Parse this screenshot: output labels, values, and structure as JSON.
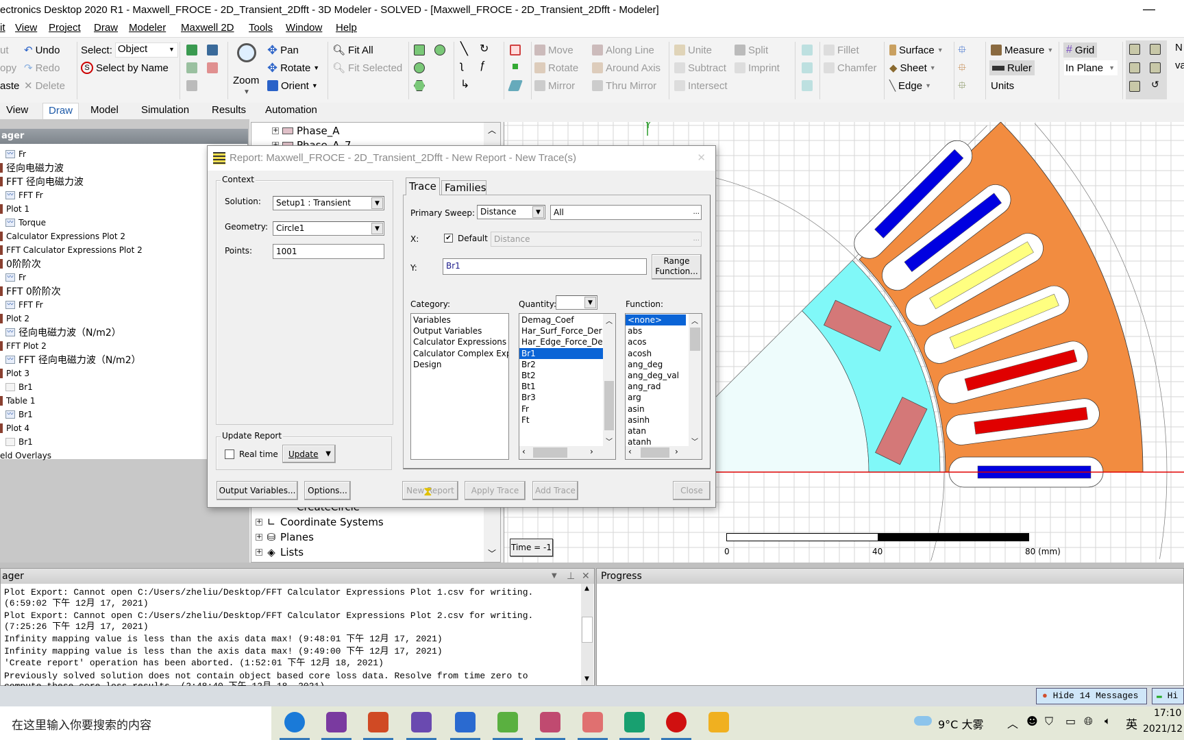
{
  "window": {
    "title": "ectronics Desktop 2020 R1 - Maxwell_FROCE - 2D_Transient_2Dfft - 3D Modeler - SOLVED - [Maxwell_FROCE - 2D_Transient_2Dfft - Modeler]",
    "minimize": "—"
  },
  "menu": [
    "it",
    "View",
    "Project",
    "Draw",
    "Modeler",
    "Maxwell 2D",
    "Tools",
    "Window",
    "Help"
  ],
  "ribbon": {
    "cut": "ut",
    "copy": "opy",
    "paste": "aste",
    "undo": "Undo",
    "redo": "Redo",
    "delete": "Delete",
    "select_label": "Select:",
    "select_value": "Object",
    "select_by_name": "Select by Name",
    "zoom": "Zoom",
    "pan": "Pan",
    "rotate": "Rotate",
    "orient": "Orient",
    "fit_all": "Fit All",
    "fit_selected": "Fit Selected",
    "move": "Move",
    "rotate2": "Rotate",
    "mirror": "Mirror",
    "along_line": "Along Line",
    "around_axis": "Around Axis",
    "thru_mirror": "Thru Mirror",
    "unite": "Unite",
    "subtract": "Subtract",
    "intersect": "Intersect",
    "split": "Split",
    "imprint": "Imprint",
    "fillet": "Fillet",
    "chamfer": "Chamfer",
    "surface": "Surface",
    "sheet": "Sheet",
    "edge": "Edge",
    "measure": "Measure",
    "ruler": "Ruler",
    "units": "Units",
    "grid": "Grid",
    "in_plane": "In Plane",
    "cut_right_1": "N",
    "cut_right_2": "va"
  },
  "tabs": [
    {
      "label": "View"
    },
    {
      "label": "Draw",
      "active": true
    },
    {
      "label": "Model"
    },
    {
      "label": "Simulation"
    },
    {
      "label": "Results"
    },
    {
      "label": "Automation"
    }
  ],
  "project_manager": {
    "header": "ager",
    "items": [
      {
        "label": "Fr",
        "level": 1,
        "icon": "trace"
      },
      {
        "label": "径向电磁力波",
        "level": 0,
        "icon": "report"
      },
      {
        "label": "FFT 径向电磁力波",
        "level": 0,
        "icon": "report"
      },
      {
        "label": "FFT Fr",
        "level": 1,
        "icon": "trace"
      },
      {
        "label": "Plot 1",
        "level": 0,
        "icon": "report"
      },
      {
        "label": "Torque",
        "level": 1,
        "icon": "trace"
      },
      {
        "label": "Calculator Expressions Plot 2",
        "level": 0,
        "icon": "report"
      },
      {
        "label": "FFT Calculator Expressions Plot 2",
        "level": 0,
        "icon": "report"
      },
      {
        "label": "0阶阶次",
        "level": 0,
        "icon": "report"
      },
      {
        "label": "Fr",
        "level": 1,
        "icon": "trace"
      },
      {
        "label": "FFT 0阶阶次",
        "level": 0,
        "icon": "report"
      },
      {
        "label": "FFT Fr",
        "level": 1,
        "icon": "trace"
      },
      {
        "label": "Plot 2",
        "level": 0,
        "icon": "report"
      },
      {
        "label": "径向电磁力波（N/m2）",
        "level": 1,
        "icon": "trace"
      },
      {
        "label": "FFT  Plot 2",
        "level": 0,
        "icon": "report"
      },
      {
        "label": "FFT 径向电磁力波（N/m2）",
        "level": 1,
        "icon": "trace"
      },
      {
        "label": "Plot 3",
        "level": 0,
        "icon": "report"
      },
      {
        "label": "Br1",
        "level": 1,
        "icon": "table"
      },
      {
        "label": "Table 1",
        "level": 0,
        "icon": "report"
      },
      {
        "label": "Br1",
        "level": 1,
        "icon": "trace"
      },
      {
        "label": "Plot 4",
        "level": 0,
        "icon": "report"
      },
      {
        "label": "Br1",
        "level": 1,
        "icon": "table"
      },
      {
        "label": "eld Overlays",
        "level": 0,
        "icon": "none"
      }
    ]
  },
  "model_tree": {
    "top_items": [
      "Phase_A",
      "Phase_A_7"
    ],
    "partial_item": "CreateCircle",
    "bottom_items": [
      "Coordinate Systems",
      "Planes",
      "Lists"
    ]
  },
  "viewer": {
    "axis_label": "Y",
    "time_label": "Time = -1",
    "scale_labels": [
      "0",
      "40",
      "80 (mm)"
    ],
    "colors": {
      "stator": "#f28c40",
      "rotor": "#80f8f8",
      "shaft": "#eefcfc",
      "magnet": "#d47878",
      "axis_line": "#e00000"
    },
    "coil_colors": [
      "#0000e0",
      "#e00000",
      "#e00000",
      "#ffff80",
      "#ffff80",
      "#0000e0",
      "#0000e0"
    ]
  },
  "dialog": {
    "title": "Report: Maxwell_FROCE - 2D_Transient_2Dfft - New Report - New Trace(s)",
    "context": {
      "label": "Context",
      "solution_label": "Solution:",
      "solution_value": "Setup1 : Transient",
      "geometry_label": "Geometry:",
      "geometry_value": "Circle1",
      "points_label": "Points:",
      "points_value": "1001"
    },
    "update_report": {
      "label": "Update Report",
      "realtime_label": "Real time",
      "realtime_checked": false,
      "update_button": "Update"
    },
    "tabs": [
      {
        "label": "Trace",
        "active": true
      },
      {
        "label": "Families"
      }
    ],
    "primary_sweep_label": "Primary Sweep:",
    "primary_sweep_value": "Distance",
    "sweep_range": "All",
    "ellipsis": "...",
    "x_label": "X:",
    "x_default_label": "Default",
    "x_default_checked": true,
    "x_value": "Distance",
    "y_label": "Y:",
    "y_value": "Br1",
    "range_function_button": "Range\nFunction...",
    "category_label": "Category:",
    "categories": [
      "Variables",
      "Output Variables",
      "Calculator Expressions",
      "Calculator Complex Expr",
      "Design"
    ],
    "quantity_label": "Quantity:",
    "quantity_filter": "",
    "quantities": [
      "Demag_Coef",
      "Har_Surf_Force_Der",
      "Har_Edge_Force_De",
      "Br1",
      "Br2",
      "Bt2",
      "Bt1",
      "Br3",
      "Fr",
      "Ft"
    ],
    "quantity_selected": "Br1",
    "function_label": "Function:",
    "functions": [
      "<none>",
      "abs",
      "acos",
      "acosh",
      "ang_deg",
      "ang_deg_val",
      "ang_rad",
      "arg",
      "asin",
      "asinh",
      "atan",
      "atanh"
    ],
    "function_selected": "<none>",
    "buttons": {
      "output_variables": "Output Variables...",
      "options": "Options...",
      "new_report": "New Report",
      "apply_trace": "Apply Trace",
      "add_trace": "Add Trace",
      "close": "Close"
    }
  },
  "messages": {
    "header": "ager",
    "lines": [
      "Plot Export: Cannot open C:/Users/zheliu/Desktop/FFT Calculator Expressions Plot 1.csv for writing.",
      "(6:59:02 下午  12月 17, 2021)",
      "Plot Export: Cannot open C:/Users/zheliu/Desktop/FFT Calculator Expressions Plot 2.csv for writing.",
      "(7:25:26 下午  12月 17, 2021)",
      "Infinity mapping value is less than the axis data max! (9:48:01 下午  12月 17, 2021)",
      "Infinity mapping value is less than the axis data max! (9:49:00 下午  12月 17, 2021)",
      "'Create report' operation has been aborted. (1:52:01 下午  12月 18, 2021)",
      "Previously solved solution does not contain object based core loss data. Resolve from time zero to",
      "compute these core loss results. (2:48:40 下午  12月 18, 2021)"
    ]
  },
  "progress": {
    "header": "Progress"
  },
  "statusbar": {
    "hide_messages": "Hide 14 Messages",
    "hide_progress": "Hi"
  },
  "taskbar": {
    "search_placeholder": "在这里输入你要搜索的内容",
    "apps": [
      "edge",
      "onenote",
      "powerpoint",
      "paint",
      "notepad",
      "electronics-desktop",
      "snipping",
      "acrobat",
      "pdf",
      "recorder",
      "explorer"
    ],
    "weather": "9°C 大雾",
    "ime": "英",
    "time": "17:10",
    "date": "2021/12"
  }
}
